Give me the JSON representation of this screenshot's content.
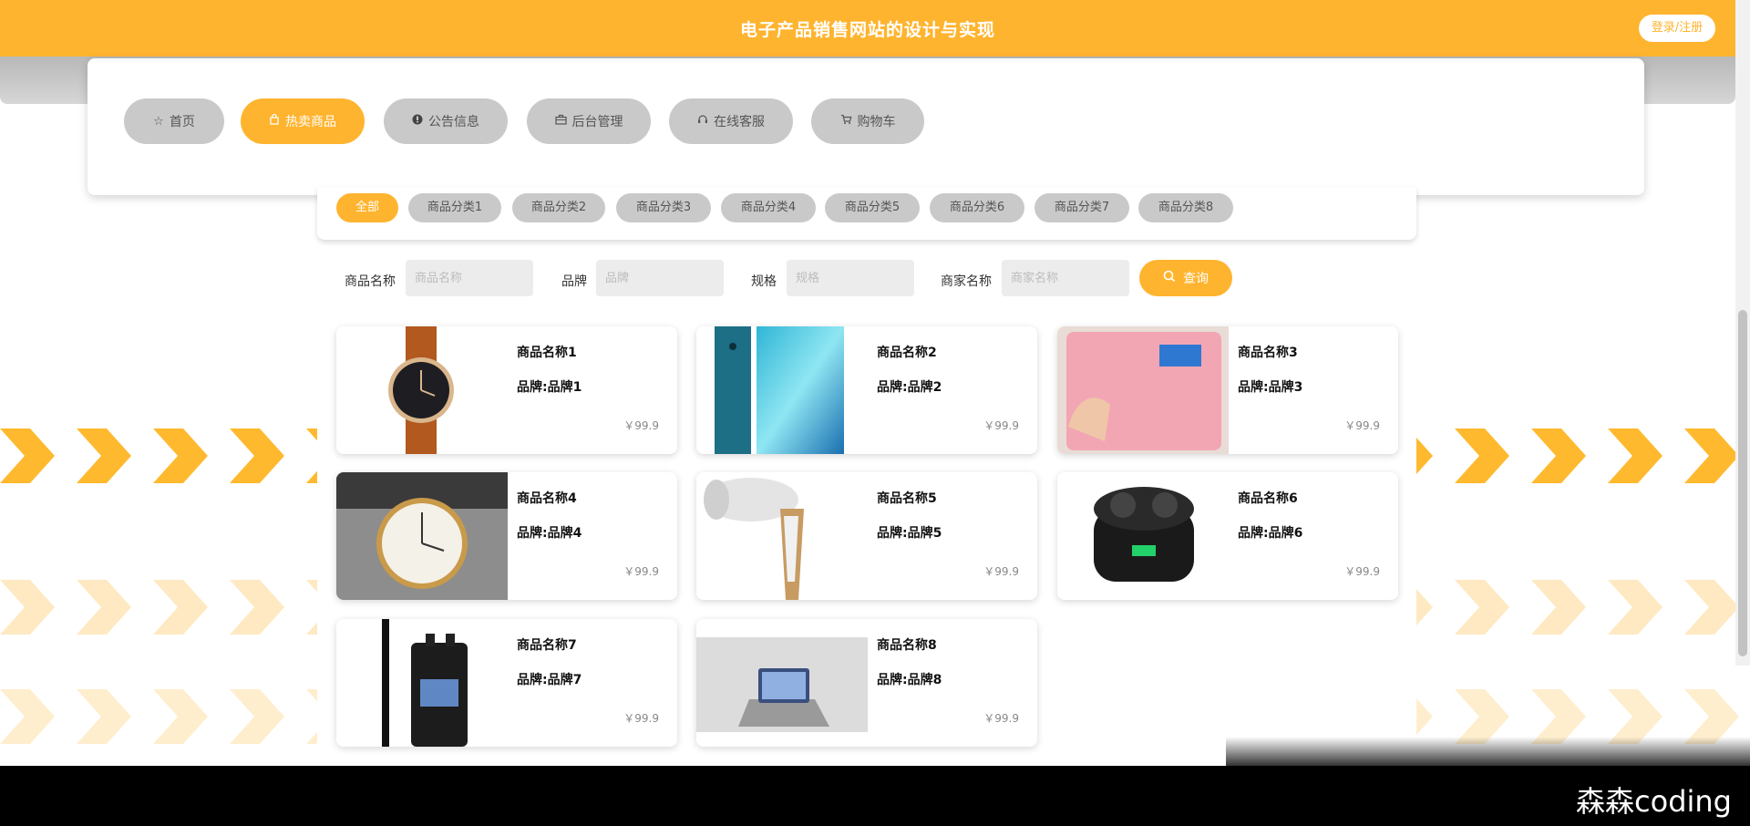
{
  "header": {
    "title": "电子产品销售网站的设计与实现",
    "login": "登录/注册"
  },
  "nav": [
    {
      "label": "首页",
      "icon": "star-icon"
    },
    {
      "label": "热卖商品",
      "icon": "bag-icon",
      "active": true
    },
    {
      "label": "公告信息",
      "icon": "info-icon"
    },
    {
      "label": "后台管理",
      "icon": "briefcase-icon"
    },
    {
      "label": "在线客服",
      "icon": "headset-icon"
    },
    {
      "label": "购物车",
      "icon": "cart-icon"
    }
  ],
  "categories": [
    {
      "label": "全部",
      "active": true
    },
    {
      "label": "商品分类1"
    },
    {
      "label": "商品分类2"
    },
    {
      "label": "商品分类3"
    },
    {
      "label": "商品分类4"
    },
    {
      "label": "商品分类5"
    },
    {
      "label": "商品分类6"
    },
    {
      "label": "商品分类7"
    },
    {
      "label": "商品分类8"
    }
  ],
  "search": {
    "name_label": "商品名称",
    "name_placeholder": "商品名称",
    "brand_label": "品牌",
    "brand_placeholder": "品牌",
    "spec_label": "规格",
    "spec_placeholder": "规格",
    "merchant_label": "商家名称",
    "merchant_placeholder": "商家名称",
    "query_label": "查询"
  },
  "products": [
    {
      "name": "商品名称1",
      "brand": "品牌:品牌1",
      "price": "￥99.9",
      "image": "wristwatch-image"
    },
    {
      "name": "商品名称2",
      "brand": "品牌:品牌2",
      "price": "￥99.9",
      "image": "smartphone-image"
    },
    {
      "name": "商品名称3",
      "brand": "品牌:品牌3",
      "price": "￥99.9",
      "image": "bathroom-scale-image"
    },
    {
      "name": "商品名称4",
      "brand": "品牌:品牌4",
      "price": "￥99.9",
      "image": "wristwatch-image"
    },
    {
      "name": "商品名称5",
      "brand": "品牌:品牌5",
      "price": "￥99.9",
      "image": "hair-dryer-image"
    },
    {
      "name": "商品名称6",
      "brand": "品牌:品牌6",
      "price": "￥99.9",
      "image": "earbuds-image"
    },
    {
      "name": "商品名称7",
      "brand": "品牌:品牌7",
      "price": "￥99.9",
      "image": "walkie-talkie-image"
    },
    {
      "name": "商品名称8",
      "brand": "品牌:品牌8",
      "price": "￥99.9",
      "image": "tablet-stand-image"
    }
  ],
  "watermark": "森森coding",
  "colors": {
    "accent": "#ffb42f",
    "chip": "#c9c9c9"
  }
}
